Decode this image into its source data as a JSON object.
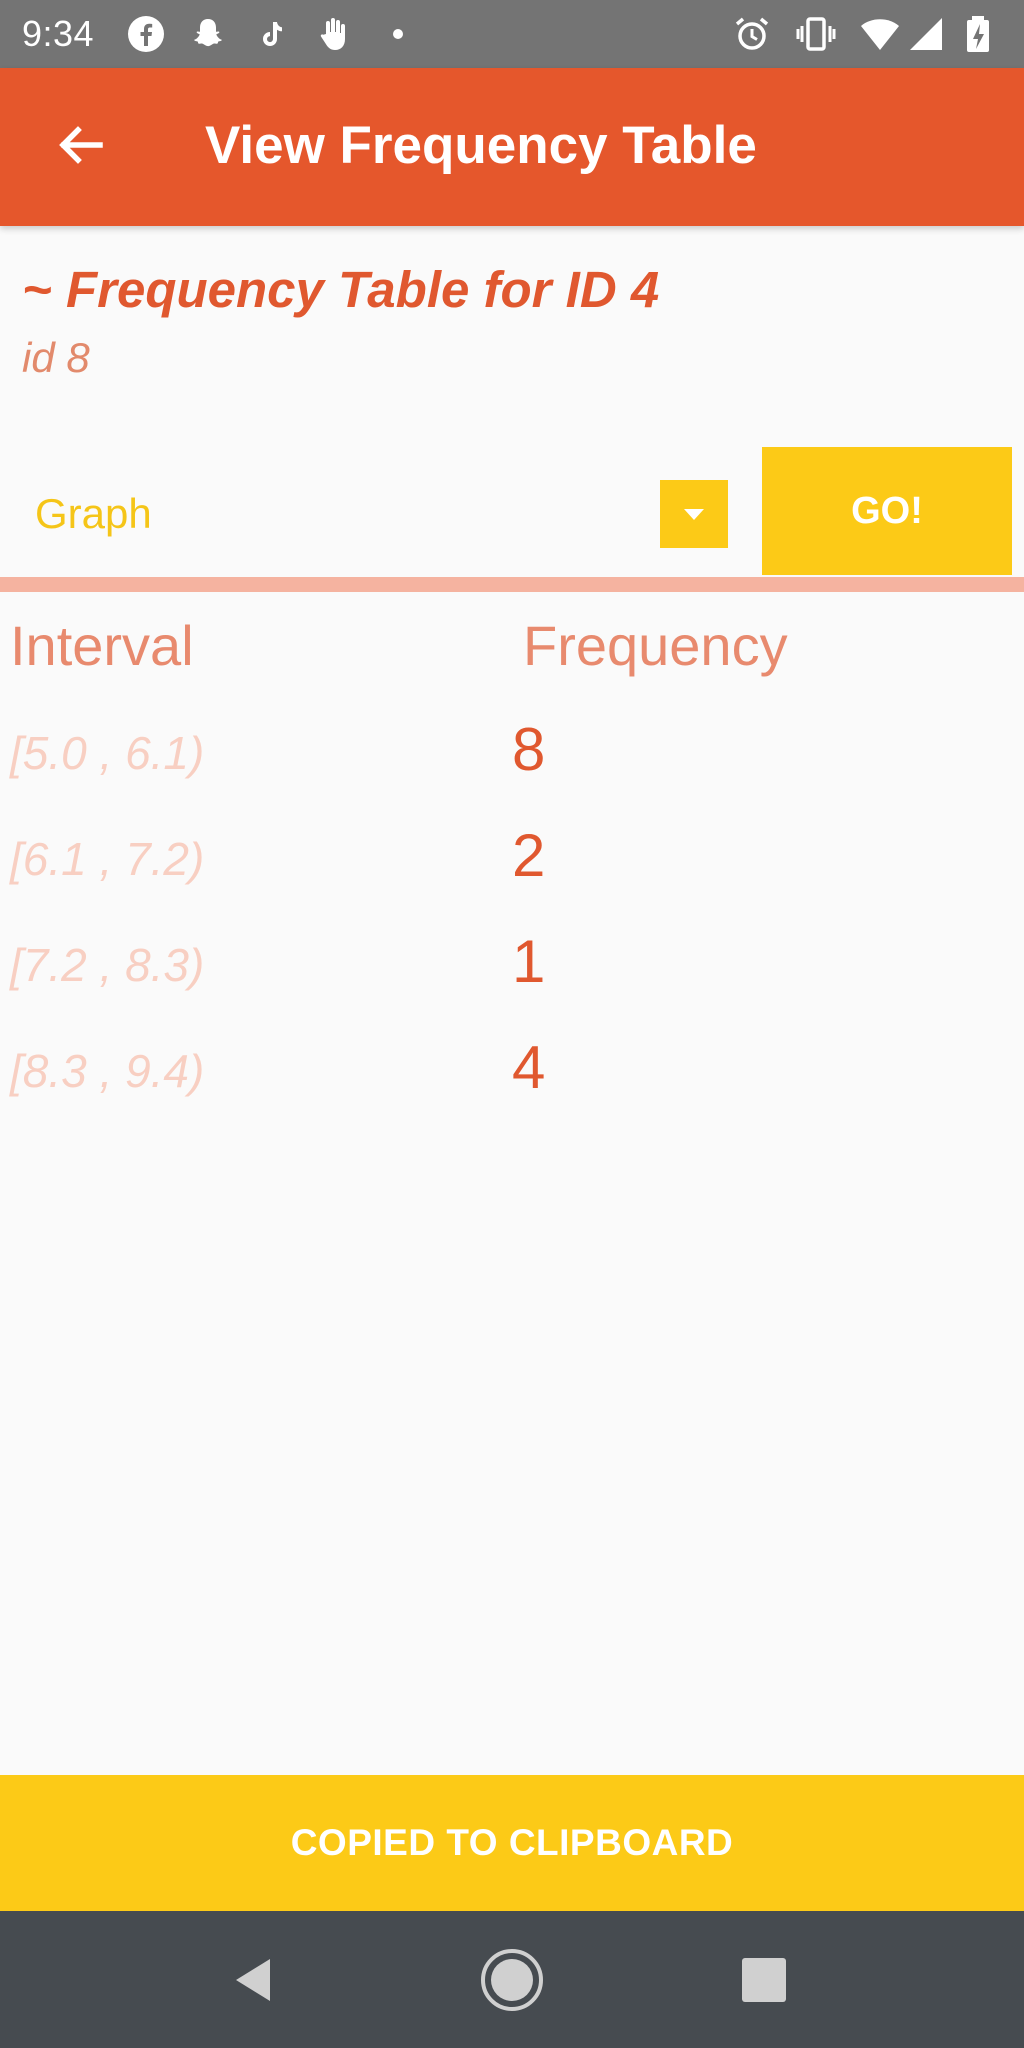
{
  "status_bar": {
    "time": "9:34",
    "left_icons": [
      "facebook-icon",
      "snapchat-icon",
      "tiktok-icon",
      "hand-icon",
      "dot-icon"
    ],
    "right_icons": [
      "alarm-icon",
      "vibrate-icon",
      "wifi-icon",
      "signal-icon",
      "battery-charging-icon"
    ]
  },
  "app_bar": {
    "title": "View Frequency Table",
    "back_icon": "arrow-back-icon"
  },
  "heading": {
    "title": "~ Frequency Table for ID 4",
    "subtitle": "id 8"
  },
  "controls": {
    "spinner_value": "Graph",
    "go_label": "GO!"
  },
  "table": {
    "headers": [
      "Interval",
      "Frequency"
    ],
    "rows": [
      {
        "interval": "[5.0 , 6.1)",
        "frequency": "8"
      },
      {
        "interval": "[6.1 , 7.2)",
        "frequency": "2"
      },
      {
        "interval": "[7.2 , 8.3)",
        "frequency": "1"
      },
      {
        "interval": "[8.3 , 9.4)",
        "frequency": "4"
      }
    ]
  },
  "snackbar": {
    "message": "COPIED TO CLIPBOARD"
  },
  "colors": {
    "primary": "#e5572c",
    "accent": "#fcca17",
    "status_bar": "#747474",
    "nav_bar": "#464b50"
  }
}
